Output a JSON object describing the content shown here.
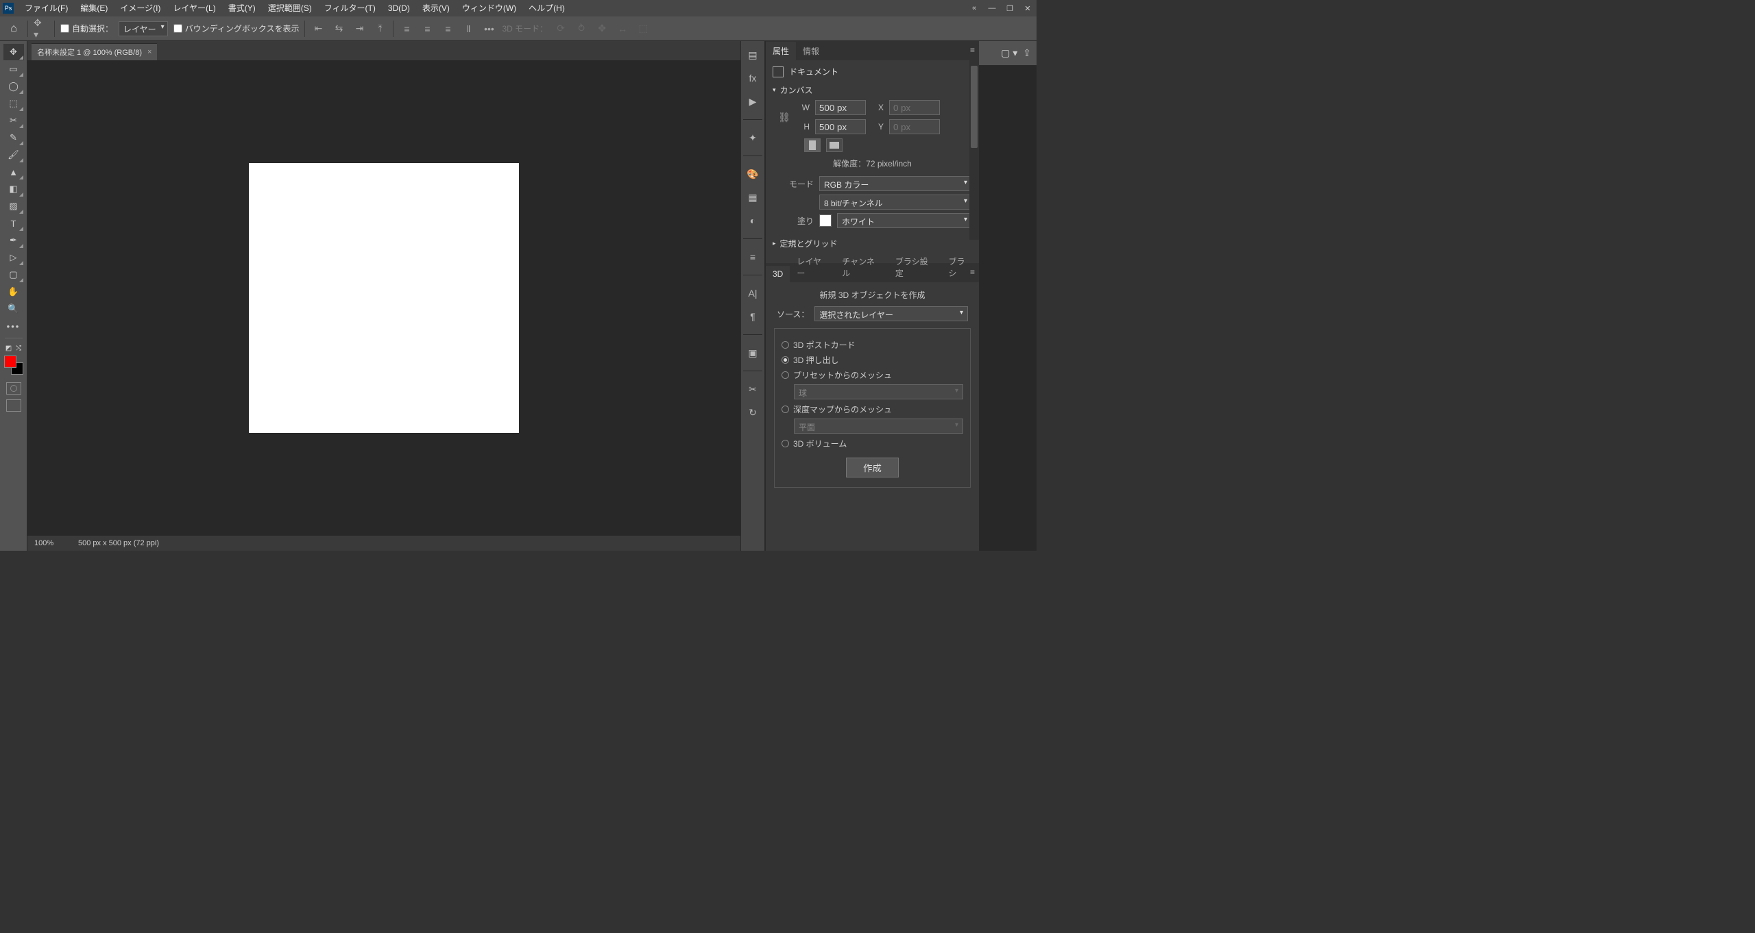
{
  "menu": {
    "file": "ファイル(F)",
    "edit": "編集(E)",
    "image": "イメージ(I)",
    "layer": "レイヤー(L)",
    "type": "書式(Y)",
    "select": "選択範囲(S)",
    "filter": "フィルター(T)",
    "threed": "3D(D)",
    "view": "表示(V)",
    "window": "ウィンドウ(W)",
    "help": "ヘルプ(H)"
  },
  "optbar": {
    "auto_select": "自動選択：",
    "layer_sel": "レイヤー",
    "show_bbox": "バウンディングボックスを表示",
    "mode3d": "3D モード："
  },
  "doc_tab": "名称未設定 1 @ 100% (RGB/8)",
  "status": {
    "zoom": "100%",
    "dims": "500 px x 500 px (72 ppi)"
  },
  "props": {
    "tab_props": "属性",
    "tab_info": "情報",
    "doc_label": "ドキュメント",
    "canvas_section": "カンバス",
    "W": "W",
    "H": "H",
    "X": "X",
    "Y": "Y",
    "w_val": "500 px",
    "h_val": "500 px",
    "xy_placeholder": "0 px",
    "resolution": "解像度：72 pixel/inch",
    "mode_lbl": "モード",
    "mode_val": "RGB カラー",
    "bit_val": "8 bit/チャンネル",
    "fill_lbl": "塗り",
    "fill_val": "ホワイト",
    "rulers_section": "定規とグリッド"
  },
  "p3d": {
    "tab_3d": "3D",
    "tab_layer": "レイヤー",
    "tab_channel": "チャンネル",
    "tab_brushset": "ブラシ設定",
    "tab_brush": "ブラシ",
    "title": "新規 3D オブジェクトを作成",
    "source_lbl": "ソース：",
    "source_val": "選択されたレイヤー",
    "opt_postcard": "3D ポストカード",
    "opt_extrude": "3D 押し出し",
    "opt_preset": "プリセットからのメッシュ",
    "preset_val": "球",
    "opt_depth": "深度マップからのメッシュ",
    "depth_val": "平面",
    "opt_volume": "3D ボリューム",
    "create": "作成"
  }
}
